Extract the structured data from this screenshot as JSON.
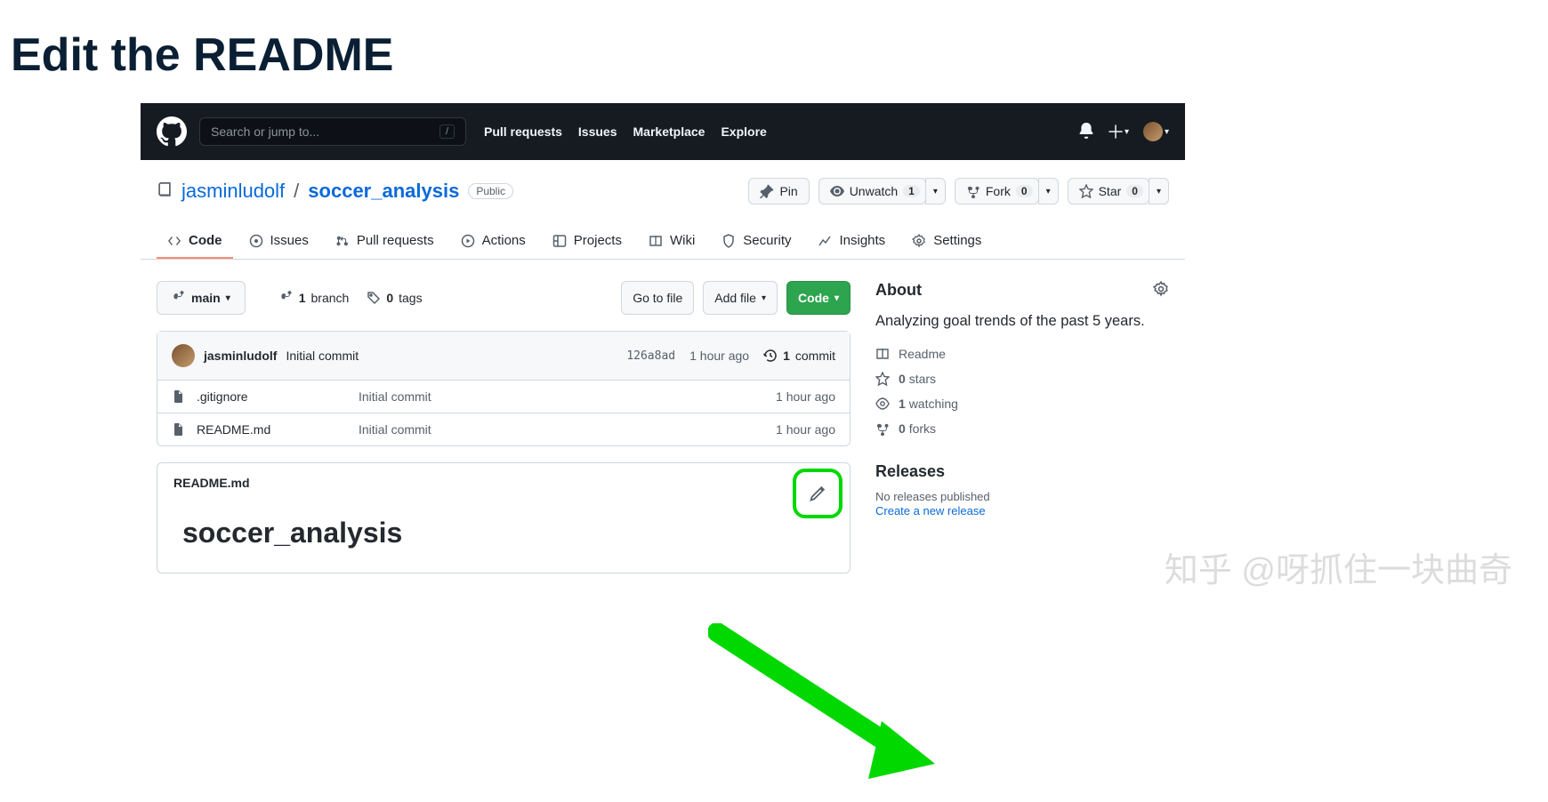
{
  "page_title": "Edit the README",
  "search": {
    "placeholder": "Search or jump to...",
    "shortcut": "/"
  },
  "top_nav": [
    "Pull requests",
    "Issues",
    "Marketplace",
    "Explore"
  ],
  "repo": {
    "owner": "jasminludolf",
    "name": "soccer_analysis",
    "visibility": "Public"
  },
  "actions": {
    "pin": "Pin",
    "unwatch": {
      "label": "Unwatch",
      "count": "1"
    },
    "fork": {
      "label": "Fork",
      "count": "0"
    },
    "star": {
      "label": "Star",
      "count": "0"
    }
  },
  "tabs": [
    "Code",
    "Issues",
    "Pull requests",
    "Actions",
    "Projects",
    "Wiki",
    "Security",
    "Insights",
    "Settings"
  ],
  "branch": {
    "current": "main",
    "branches": {
      "count": "1",
      "label": "branch"
    },
    "tags": {
      "count": "0",
      "label": "tags"
    }
  },
  "buttons": {
    "go_to_file": "Go to file",
    "add_file": "Add file",
    "code": "Code"
  },
  "commit": {
    "author": "jasminludolf",
    "message": "Initial commit",
    "sha": "126a8ad",
    "time": "1 hour ago",
    "total_count": "1",
    "total_label": "commit"
  },
  "files": [
    {
      "name": ".gitignore",
      "msg": "Initial commit",
      "time": "1 hour ago"
    },
    {
      "name": "README.md",
      "msg": "Initial commit",
      "time": "1 hour ago"
    }
  ],
  "readme": {
    "filename": "README.md",
    "heading": "soccer_analysis"
  },
  "about": {
    "title": "About",
    "description": "Analyzing goal trends of the past 5 years.",
    "items": {
      "readme": "Readme",
      "stars": {
        "count": "0",
        "label": "stars"
      },
      "watching": {
        "count": "1",
        "label": "watching"
      },
      "forks": {
        "count": "0",
        "label": "forks"
      }
    }
  },
  "releases": {
    "title": "Releases",
    "empty": "No releases published",
    "create": "Create a new release"
  },
  "watermark": "知乎 @呀抓住一块曲奇"
}
